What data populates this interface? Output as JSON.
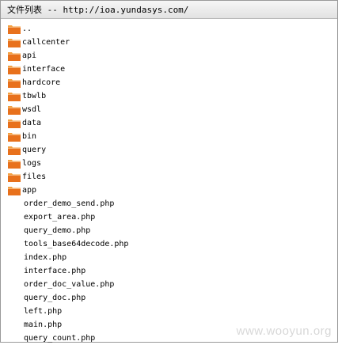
{
  "header": {
    "title": "文件列表 -- http://ioa.yundasys.com/"
  },
  "entries": [
    {
      "name": "..",
      "type": "folder"
    },
    {
      "name": "callcenter",
      "type": "folder"
    },
    {
      "name": "api",
      "type": "folder"
    },
    {
      "name": "interface",
      "type": "folder"
    },
    {
      "name": "hardcore",
      "type": "folder"
    },
    {
      "name": "tbwlb",
      "type": "folder"
    },
    {
      "name": "wsdl",
      "type": "folder"
    },
    {
      "name": "data",
      "type": "folder"
    },
    {
      "name": "bin",
      "type": "folder"
    },
    {
      "name": "query",
      "type": "folder"
    },
    {
      "name": "logs",
      "type": "folder"
    },
    {
      "name": "files",
      "type": "folder"
    },
    {
      "name": "app",
      "type": "folder"
    },
    {
      "name": "order_demo_send.php",
      "type": "file"
    },
    {
      "name": "export_area.php",
      "type": "file"
    },
    {
      "name": "query_demo.php",
      "type": "file"
    },
    {
      "name": "tools_base64decode.php",
      "type": "file"
    },
    {
      "name": "index.php",
      "type": "file"
    },
    {
      "name": "interface.php",
      "type": "file"
    },
    {
      "name": "order_doc_value.php",
      "type": "file"
    },
    {
      "name": "query_doc.php",
      "type": "file"
    },
    {
      "name": "left.php",
      "type": "file"
    },
    {
      "name": "main.php",
      "type": "file"
    },
    {
      "name": "query_count.php",
      "type": "file"
    }
  ],
  "watermark": "www.wooyun.org",
  "colors": {
    "folder_body": "#e8711c",
    "folder_tab": "#f4a040"
  }
}
